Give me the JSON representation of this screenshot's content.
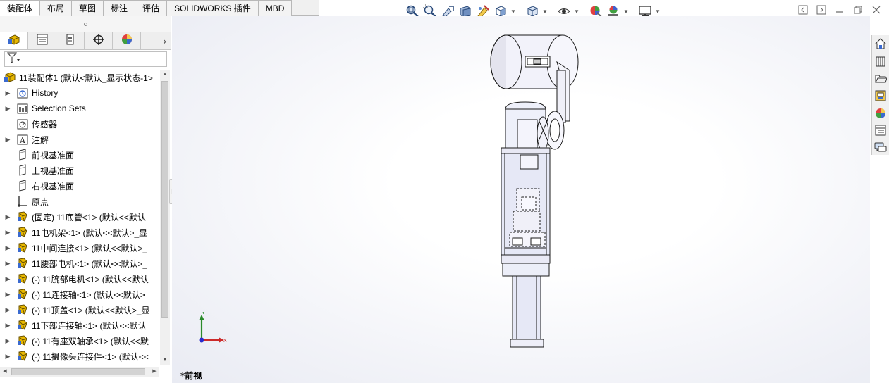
{
  "command_tabs": [
    {
      "label": "装配体",
      "active": true
    },
    {
      "label": "布局",
      "active": false
    },
    {
      "label": "草图",
      "active": false
    },
    {
      "label": "标注",
      "active": false
    },
    {
      "label": "评估",
      "active": false
    },
    {
      "label": "SOLIDWORKS 插件",
      "active": false
    },
    {
      "label": "MBD",
      "active": false
    }
  ],
  "view_toolbar_icons": [
    "zoom-to-fit-icon",
    "zoom-to-area-icon",
    "previous-view-icon",
    "section-view-icon",
    "dynamic-annotation-icon",
    "view-orientation-icon",
    "display-style-icon",
    "hide-show-items-icon",
    "edit-appearance-icon",
    "apply-scene-icon",
    "view-settings-icon"
  ],
  "feature_tree": {
    "root": "11装配体1 (默认<默认_显示状态-1>",
    "items": [
      {
        "label": "History",
        "expandable": true,
        "icon": "history-icon"
      },
      {
        "label": "Selection Sets",
        "expandable": true,
        "icon": "selection-sets-icon"
      },
      {
        "label": "传感器",
        "expandable": false,
        "icon": "sensor-icon"
      },
      {
        "label": "注解",
        "expandable": true,
        "icon": "annotations-icon"
      },
      {
        "label": "前视基准面",
        "expandable": false,
        "icon": "plane-icon"
      },
      {
        "label": "上视基准面",
        "expandable": false,
        "icon": "plane-icon"
      },
      {
        "label": "右视基准面",
        "expandable": false,
        "icon": "plane-icon"
      },
      {
        "label": "原点",
        "expandable": false,
        "icon": "origin-icon"
      },
      {
        "label": "(固定) 11底管<1> (默认<<默认",
        "expandable": true,
        "icon": "part-icon"
      },
      {
        "label": "11电机架<1> (默认<<默认>_显",
        "expandable": true,
        "icon": "part-icon"
      },
      {
        "label": "11中间连接<1> (默认<<默认>_",
        "expandable": true,
        "icon": "part-icon"
      },
      {
        "label": "11腰部电机<1> (默认<<默认>_",
        "expandable": true,
        "icon": "part-icon"
      },
      {
        "label": "(-) 11腕部电机<1> (默认<<默认",
        "expandable": true,
        "icon": "part-icon"
      },
      {
        "label": "(-) 11连接轴<1> (默认<<默认>",
        "expandable": true,
        "icon": "part-icon"
      },
      {
        "label": "(-) 11顶盖<1> (默认<<默认>_显",
        "expandable": true,
        "icon": "part-icon"
      },
      {
        "label": "11下部连接轴<1> (默认<<默认",
        "expandable": true,
        "icon": "part-icon"
      },
      {
        "label": "(-) 11有座双轴承<1> (默认<<默",
        "expandable": true,
        "icon": "part-icon"
      },
      {
        "label": "(-) 11摄像头连接件<1> (默认<<",
        "expandable": true,
        "icon": "part-icon"
      }
    ]
  },
  "viewport": {
    "view_name": "*前视",
    "triad": {
      "x_label": "X",
      "y_label": "Y"
    }
  },
  "colors": {
    "x_axis": "#cc2a2a",
    "y_axis": "#2a8a2a",
    "z_axis": "#2a2acc",
    "model_edge": "#1a1a1a",
    "model_fill": "#eeeef8",
    "part_icon": "#e8b800"
  }
}
